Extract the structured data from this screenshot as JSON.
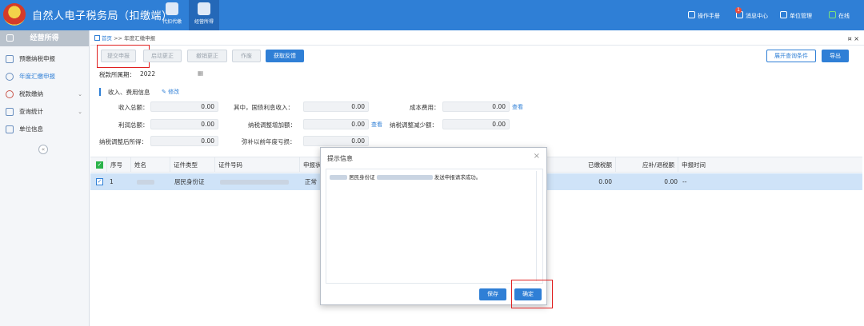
{
  "header": {
    "app_title": "自然人电子税务局（扣缴端）",
    "modules": [
      {
        "label": "代扣代缴"
      },
      {
        "label": "经营所得"
      }
    ],
    "links": [
      {
        "label": "操作手册"
      },
      {
        "label": "消息中心",
        "badge": "1"
      },
      {
        "label": "单位管理"
      },
      {
        "label": "在线"
      }
    ]
  },
  "sidebar": {
    "title": "经营所得",
    "items": [
      {
        "label": "预缴纳税申报"
      },
      {
        "label": "年度汇缴申报"
      },
      {
        "label": "税款缴纳"
      },
      {
        "label": "查询统计"
      },
      {
        "label": "单位信息"
      }
    ],
    "collapse": "«"
  },
  "breadcrumb": {
    "home": "首页",
    "sep": ">>",
    "current": "年度汇缴申报",
    "close": "¤ ×"
  },
  "toolbar": {
    "submit": "提交申报",
    "start_correct": "启动更正",
    "cancel_correct": "撤销更正",
    "void": "作废",
    "get_feedback": "获取反馈",
    "expand_query": "展开查询条件",
    "export": "导出"
  },
  "period": {
    "label": "税款所属期：",
    "value": "2022"
  },
  "income_section": {
    "title": "收入、费用信息",
    "edit": "修改",
    "fields": {
      "total_income": {
        "label": "收入总额：",
        "value": "0.00"
      },
      "bond_interest": {
        "label": "其中，国债利息收入：",
        "value": "0.00"
      },
      "cost": {
        "label": "成本费用：",
        "value": "0.00"
      },
      "cost_link": "查看",
      "total_profit": {
        "label": "利润总额：",
        "value": "0.00"
      },
      "adj_increase": {
        "label": "纳税调整增加额：",
        "value": "0.00"
      },
      "adj_increase_link": "查看",
      "adj_decrease": {
        "label": "纳税调整减少额：",
        "value": "0.00"
      },
      "adjusted_income": {
        "label": "纳税调整后所得：",
        "value": "0.00"
      },
      "loss_offset": {
        "label": "弥补以前年度亏损：",
        "value": "0.00"
      }
    }
  },
  "table": {
    "headers": [
      "序号",
      "姓名",
      "证件类型",
      "证件号码",
      "申报状",
      "已缴税额",
      "应补/退税额",
      "申报时间"
    ],
    "rows": [
      {
        "index": "1",
        "id_type": "居民身份证",
        "status": "正常",
        "paid": "0.00",
        "refund": "0.00",
        "time": "--"
      }
    ]
  },
  "dialog": {
    "title": "提示信息",
    "close": "×",
    "message_prefix": "居民身份证",
    "message_suffix": "发送申报请求成功。",
    "save": "保存",
    "confirm": "确定"
  }
}
